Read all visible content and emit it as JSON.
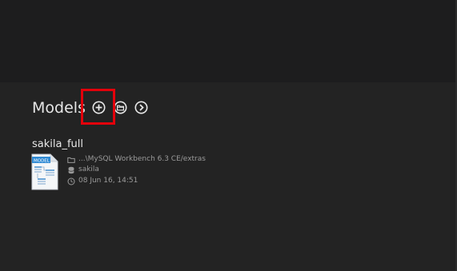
{
  "models": {
    "title": "Models",
    "actions": {
      "add_icon": "plus-circle-icon",
      "open_icon": "open-folder-icon",
      "browse_icon": "chevron-right-circle-icon"
    }
  },
  "tile": {
    "name": "sakila_full",
    "file_badge": "MODEL",
    "path": "...\\MySQL Workbench 6.3 CE/extras",
    "schema": "sakila",
    "modified": "08 Jun 16, 14:51"
  },
  "colors": {
    "background": "#1d1d1e",
    "panel": "#232323",
    "highlight": "#e3000b",
    "text": "#e6e6e6",
    "meta_text": "#9a9a9a"
  }
}
